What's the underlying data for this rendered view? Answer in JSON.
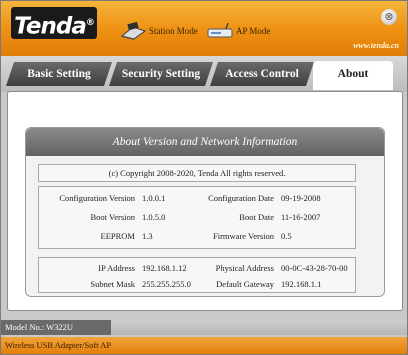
{
  "header": {
    "logo": "Tenda",
    "station_mode_label": "Station Mode",
    "ap_mode_label": "AP Mode",
    "close_glyph": "⊗",
    "url": "www.tenda.cn"
  },
  "tabs": {
    "basic": "Basic Setting",
    "security": "Security Setting",
    "access": "Access Control",
    "about": "About",
    "active": "About"
  },
  "about": {
    "title": "About Version and Network Information",
    "copyright": "(c) Copyright 2008-2020, Tenda All rights reserved.",
    "version": {
      "config_version_label": "Configuration Version",
      "config_version": "1.0.0.1",
      "config_date_label": "Configuration Date",
      "config_date": "09-19-2008",
      "boot_version_label": "Boot Version",
      "boot_version": "1.0.5.0",
      "boot_date_label": "Boot Date",
      "boot_date": "11-16-2007",
      "eeprom_label": "EEPROM",
      "eeprom": "1.3",
      "firmware_label": "Firmware Version",
      "firmware": "0.5"
    },
    "network": {
      "ip_label": "IP Address",
      "ip": "192.168.1.12",
      "mac_label": "Physical Address",
      "mac": "00-0C-43-28-70-00",
      "mask_label": "Subnet Mask",
      "mask": "255.255.255.0",
      "gateway_label": "Default Gateway",
      "gateway": "192.168.1.1"
    }
  },
  "footer": {
    "model": "Model No.: W322U",
    "description": "Wireless USB Adapter/Soft AP"
  },
  "colors": {
    "header_orange": "#ee8f12",
    "tab_dark": "#4f4f4f",
    "title_bar": "#707070"
  }
}
